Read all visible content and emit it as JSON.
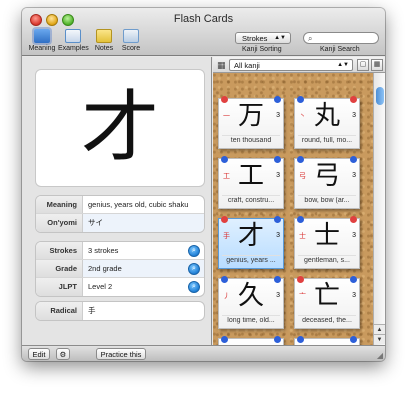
{
  "window": {
    "title": "Flash Cards"
  },
  "toolbar": {
    "items": [
      {
        "label": "Meaning",
        "icon": "meaning-icon",
        "color": "#3d7fd0"
      },
      {
        "label": "Examples",
        "icon": "examples-icon",
        "color": "#5a8fc9"
      },
      {
        "label": "Notes",
        "icon": "notes-icon",
        "color": "#e3c23a"
      },
      {
        "label": "Score",
        "icon": "score-icon",
        "color": "#6f9ccc"
      }
    ],
    "sort_value": "Strokes",
    "sort_label": "Kanji Sorting",
    "search_label": "Kanji Search",
    "search_placeholder": ""
  },
  "detail": {
    "kanji": "才",
    "group1": [
      {
        "label": "Meaning",
        "value": "genius, years old, cubic shaku"
      },
      {
        "label": "On'yomi",
        "value": "サイ"
      }
    ],
    "group2": [
      {
        "label": "Strokes",
        "value": "3 strokes"
      },
      {
        "label": "Grade",
        "value": "2nd grade"
      },
      {
        "label": "JLPT",
        "value": "Level 2"
      }
    ],
    "group3": [
      {
        "label": "Radical",
        "value": "手"
      }
    ]
  },
  "cards_header": {
    "filter": "All kanji"
  },
  "cards": [
    {
      "kanji": "万",
      "radical": "一",
      "strokes": "3",
      "meaning": "ten thousand",
      "pin_left": "#e04040",
      "pin_right": "#2d5fd9"
    },
    {
      "kanji": "丸",
      "radical": "丶",
      "strokes": "3",
      "meaning": "round, full, mo...",
      "pin_left": "#2d5fd9",
      "pin_right": "#e04040"
    },
    {
      "kanji": "工",
      "radical": "工",
      "strokes": "3",
      "meaning": "craft, constru...",
      "pin_left": "#2d5fd9",
      "pin_right": "#2d5fd9"
    },
    {
      "kanji": "弓",
      "radical": "弓",
      "strokes": "3",
      "meaning": "bow, bow (ar...",
      "pin_left": "#2d5fd9",
      "pin_right": "#2d5fd9"
    },
    {
      "kanji": "才",
      "radical": "手",
      "strokes": "3",
      "meaning": "genius, years ...",
      "pin_left": "#e04040",
      "pin_right": "#2d5fd9",
      "selected": true
    },
    {
      "kanji": "士",
      "radical": "士",
      "strokes": "3",
      "meaning": "gentleman, s...",
      "pin_left": "#2d5fd9",
      "pin_right": "#e04040"
    },
    {
      "kanji": "久",
      "radical": "丿",
      "strokes": "3",
      "meaning": "long time, old...",
      "pin_left": "#2d5fd9",
      "pin_right": "#2d5fd9"
    },
    {
      "kanji": "亡",
      "radical": "亠",
      "strokes": "3",
      "meaning": "deceased, the...",
      "pin_left": "#e04040",
      "pin_right": "#2d5fd9"
    },
    {
      "kanji": "",
      "radical": "",
      "strokes": "",
      "meaning": "",
      "pin_left": "#2d5fd9",
      "pin_right": "#2d5fd9"
    },
    {
      "kanji": "",
      "radical": "",
      "strokes": "",
      "meaning": "",
      "pin_left": "#2d5fd9",
      "pin_right": "#2d5fd9"
    }
  ],
  "bottom": {
    "edit_label": "Edit",
    "practice_label": "Practice this"
  }
}
